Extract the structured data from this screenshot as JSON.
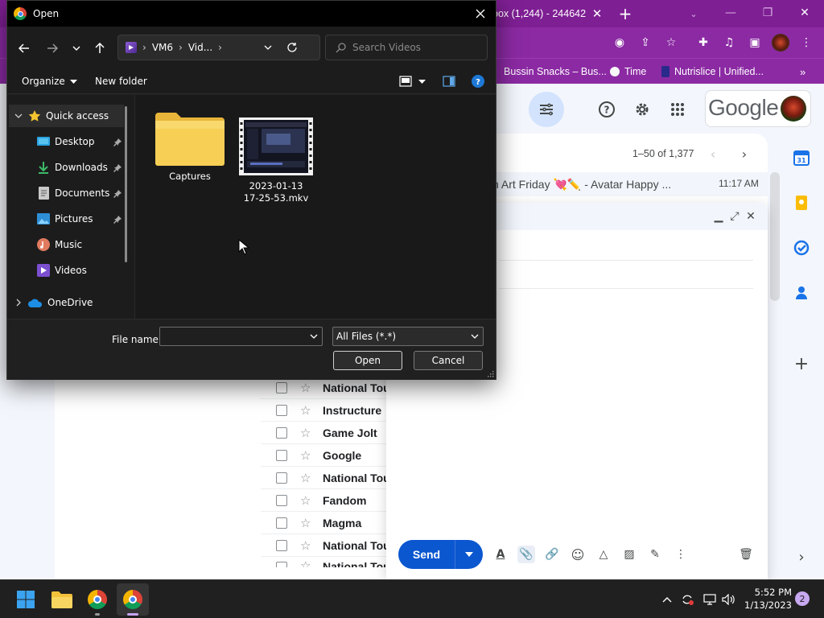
{
  "chrome": {
    "tab_title": "box (1,244) - 244642",
    "bookmarks": [
      "Bussin Snacks – Bus...",
      "Time",
      "Nutrislice | Unified..."
    ]
  },
  "gmail": {
    "brand": "Google",
    "pager": "1–50 of 1,377",
    "first_row": {
      "subject": "n Art Friday 💘✏️ - Avatar Happy ...",
      "time": "11:17 AM"
    },
    "senders": [
      "National Tou",
      "Instructure",
      "Game Jolt",
      "Google",
      "National Tou",
      "Fandom",
      "Magma",
      "National Tou",
      "National Tou"
    ],
    "send_label": "Send"
  },
  "dialog": {
    "title": "Open",
    "path": [
      "VM6",
      "Vid...",
      ""
    ],
    "search_placeholder": "Search Videos",
    "organize": "Organize",
    "new_folder": "New folder",
    "nav": {
      "quick_access": "Quick access",
      "items": [
        "Desktop",
        "Downloads",
        "Documents",
        "Pictures",
        "Music",
        "Videos"
      ],
      "onedrive": "OneDrive"
    },
    "files": [
      {
        "name": "Captures",
        "type": "folder"
      },
      {
        "name": "2023-01-13 17-25-53.mkv",
        "type": "video"
      }
    ],
    "filename_label": "File name:",
    "filename_value": "",
    "filter_value": "All Files (*.*)",
    "open_label": "Open",
    "cancel_label": "Cancel"
  },
  "taskbar": {
    "time": "5:52 PM",
    "date": "1/13/2023",
    "notification_count": "2"
  },
  "colors": {
    "chrome_purple": "#8b2aa3",
    "dialog_bg": "#202020",
    "gmail_blue": "#0b57d0",
    "taskbar": "#202020"
  }
}
